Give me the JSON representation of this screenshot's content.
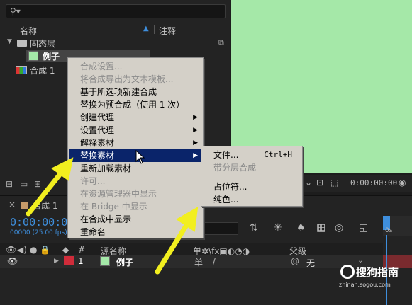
{
  "project": {
    "search_icon": "search-icon",
    "col_name": "名称",
    "col_note": "注释",
    "folder_label": "固态层",
    "solid_label": "例子",
    "comp_label": "合成 1"
  },
  "menu": {
    "items": [
      {
        "label": "合成设置...",
        "disabled": true
      },
      {
        "label": "将合成导出为文本模板...",
        "disabled": true
      },
      {
        "label": "基于所选项新建合成",
        "disabled": false
      },
      {
        "label": "替换为预合成（使用 1 次）",
        "disabled": false
      },
      {
        "label": "创建代理",
        "disabled": false,
        "submenu": true
      },
      {
        "label": "设置代理",
        "disabled": false,
        "submenu": true
      },
      {
        "label": "解释素材",
        "disabled": false,
        "submenu": true
      },
      {
        "label": "替换素材",
        "disabled": false,
        "submenu": true,
        "highlighted": true
      },
      {
        "label": "重新加载素材",
        "disabled": false
      },
      {
        "label": "许可...",
        "disabled": true
      },
      {
        "label": "在资源管理器中显示",
        "disabled": true
      },
      {
        "label": "在 Bridge 中显示",
        "disabled": true
      },
      {
        "label": "在合成中显示",
        "disabled": false
      },
      {
        "label": "重命名",
        "disabled": false
      }
    ]
  },
  "submenu": {
    "file_label": "文件...",
    "file_shortcut": "Ctrl+H",
    "layered_label": "带分层合成",
    "placeholder_label": "占位符...",
    "solid_label": "纯色..."
  },
  "viewer": {
    "time": "0:00:00:00",
    "bg_color": "#a5e8a8"
  },
  "timeline": {
    "tab_label": "合成 1",
    "timecode": "0:00:00:00",
    "fps": "00000 (25.00 fps)",
    "ruler_tick": "0s",
    "col_num": "#",
    "col_source": "源名称",
    "col_parent": "父级",
    "layer_num": "1",
    "layer_name": "例子",
    "parent_value": "无"
  },
  "watermark": {
    "text": "搜狗指南",
    "url": "zhinan.sogou.com"
  }
}
